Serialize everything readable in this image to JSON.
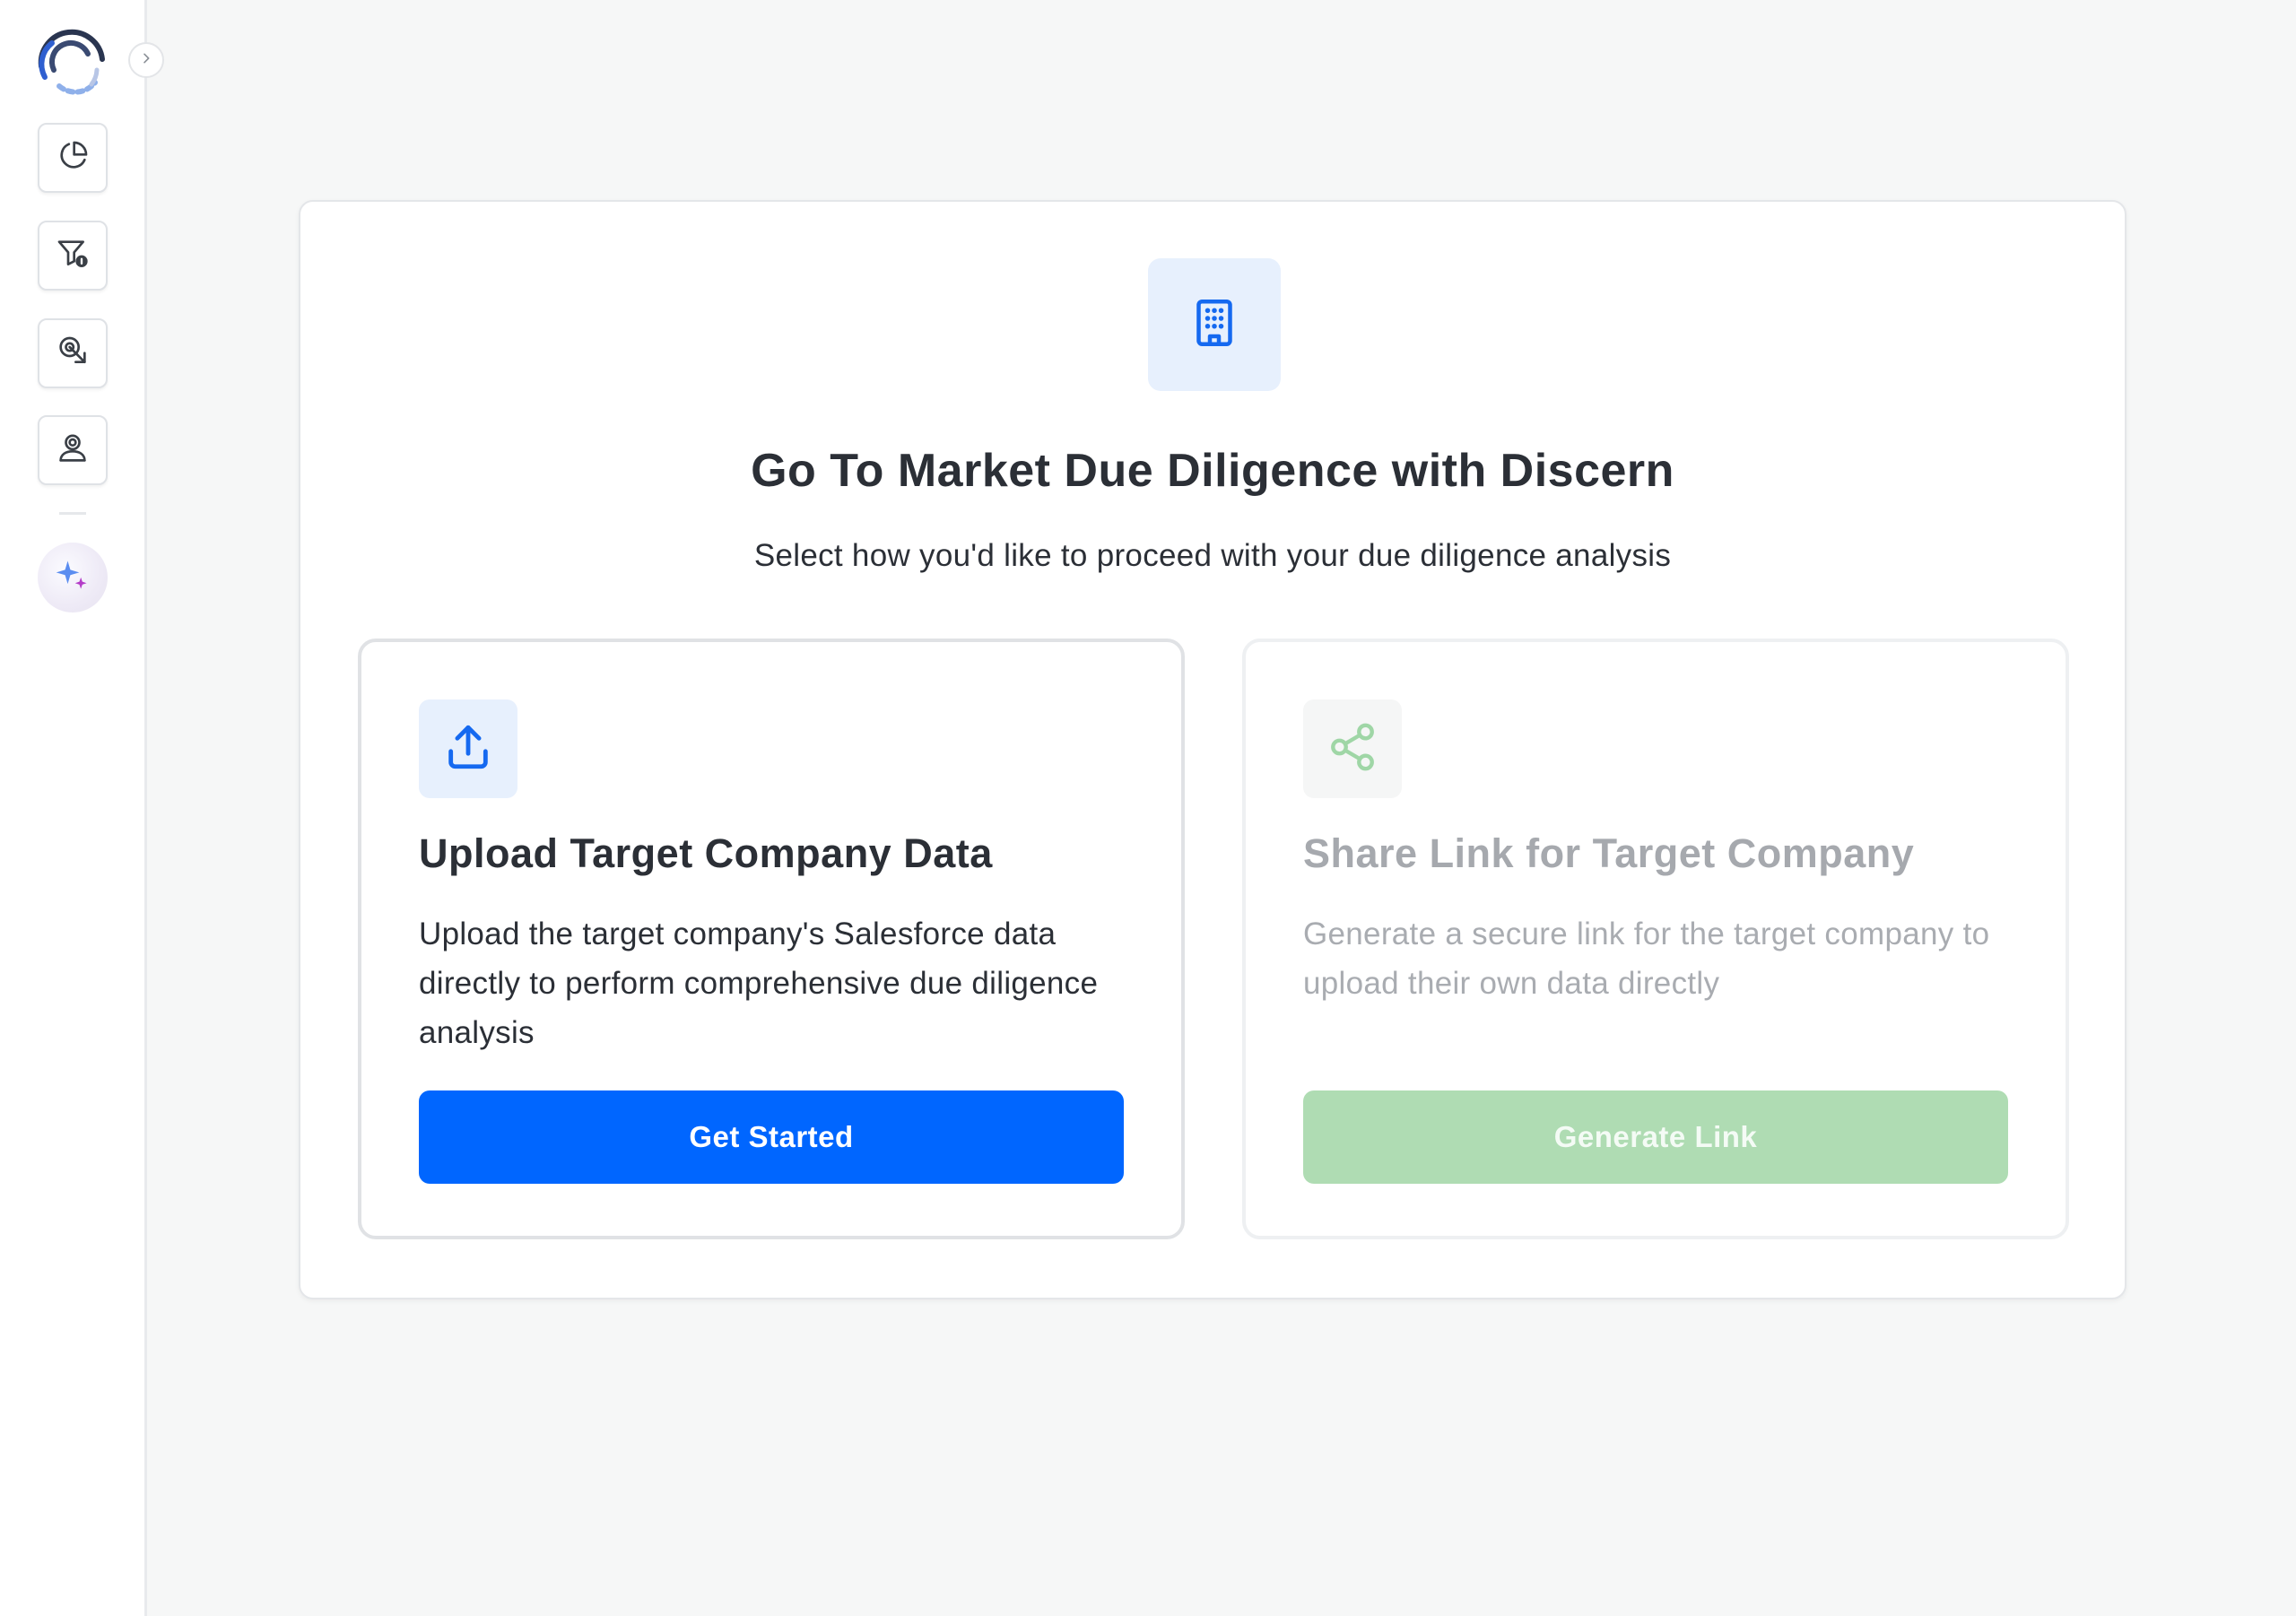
{
  "sidebar": {
    "nav_items": [
      {
        "icon": "pie-chart-icon"
      },
      {
        "icon": "filter-info-icon"
      },
      {
        "icon": "touch-pointer-icon"
      },
      {
        "icon": "user-badge-icon"
      }
    ],
    "ai_icon": "sparkles-icon"
  },
  "main": {
    "hero_icon": "building-icon",
    "title": "Go To Market Due Diligence with Discern",
    "subtitle": "Select how you'd like to proceed with your due diligence analysis",
    "cards": [
      {
        "icon": "upload-icon",
        "title": "Upload Target Company Data",
        "description": "Upload the target company's Salesforce data directly to perform comprehensive due diligence analysis",
        "button_label": "Get Started",
        "enabled": true
      },
      {
        "icon": "share-icon",
        "title": "Share Link for Target Company",
        "description": "Generate a secure link for the target company to upload their own data directly",
        "button_label": "Generate Link",
        "enabled": false
      }
    ]
  },
  "colors": {
    "primary": "#0066ff",
    "disabled_green": "#afdcb3",
    "icon_tint_bg": "#e7f0fd",
    "background": "#f6f7f7"
  }
}
